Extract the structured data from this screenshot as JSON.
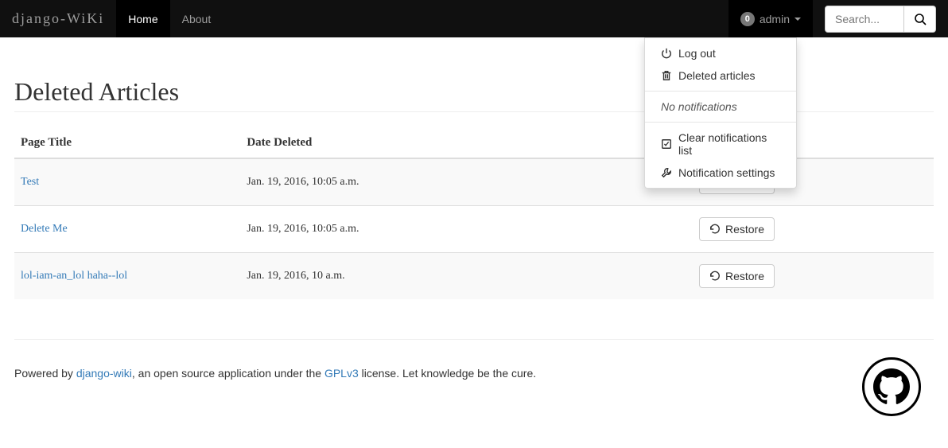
{
  "brand": "django-WiKi",
  "nav": {
    "home": "Home",
    "about": "About"
  },
  "user": {
    "badge": "0",
    "name": "admin"
  },
  "search": {
    "placeholder": "Search..."
  },
  "dropdown": {
    "logout": "Log out",
    "deleted_articles": "Deleted articles",
    "no_notifications": "No notifications",
    "clear_notifications": "Clear notifications list",
    "settings": "Notification settings"
  },
  "page": {
    "title": "Deleted Articles",
    "col_title": "Page Title",
    "col_date": "Date Deleted",
    "restore_label": "Restore"
  },
  "rows": [
    {
      "title": "Test",
      "date": "Jan. 19, 2016, 10:05 a.m."
    },
    {
      "title": "Delete Me",
      "date": "Jan. 19, 2016, 10:05 a.m."
    },
    {
      "title": "lol-iam-an_lol haha--lol",
      "date": "Jan. 19, 2016, 10 a.m."
    }
  ],
  "footer": {
    "pre": "Powered by ",
    "link1": "django-wiki",
    "mid": ", an open source application under the ",
    "link2": "GPLv3",
    "post": " license. Let knowledge be the cure."
  }
}
